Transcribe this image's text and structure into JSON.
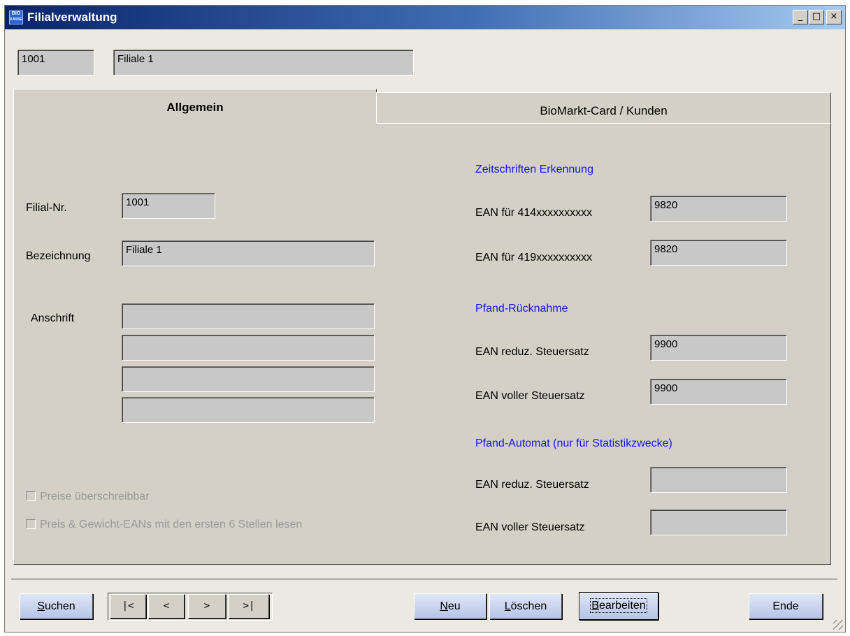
{
  "window": {
    "title": "Filialverwaltung",
    "logo_line1": "BIO",
    "logo_line2": "KASSE",
    "minimize": "_",
    "maximize": "□",
    "close": "×"
  },
  "header": {
    "number": "1001",
    "name": "Filiale 1"
  },
  "tabs": [
    {
      "label": "Allgemein",
      "active": true
    },
    {
      "label": "BioMarkt-Card / Kunden",
      "active": false
    }
  ],
  "general": {
    "filial_nr_label": "Filial-Nr.",
    "filial_nr_value": "1001",
    "bezeichnung_label": "Bezeichnung",
    "bezeichnung_value": "Filiale 1",
    "anschrift_label": "Anschrift",
    "anschrift_lines": [
      "",
      "",
      "",
      ""
    ],
    "checkbox_preise": "Preise überschreibbar",
    "checkbox_ean": "Preis & Gewicht-EANs mit den ersten 6 Stellen lesen"
  },
  "zeitschriften": {
    "heading": "Zeitschriften Erkennung",
    "ean414_label": "EAN für 414xxxxxxxxxx",
    "ean414_value": "9820",
    "ean419_label": "EAN für 419xxxxxxxxxx",
    "ean419_value": "9820"
  },
  "pfand_ruecknahme": {
    "heading": "Pfand-Rücknahme",
    "reduz_label": "EAN reduz. Steuersatz",
    "reduz_value": "9900",
    "voll_label": "EAN voller Steuersatz",
    "voll_value": "9900"
  },
  "pfand_automat": {
    "heading": "Pfand-Automat (nur für Statistikzwecke)",
    "reduz_label": "EAN reduz. Steuersatz",
    "reduz_value": "",
    "voll_label": "EAN voller Steuersatz",
    "voll_value": ""
  },
  "buttons": {
    "suchen_u": "S",
    "suchen_rest": "uchen",
    "nav_first": "|<",
    "nav_prev": "<",
    "nav_next": ">",
    "nav_last": ">|",
    "neu_u": "N",
    "neu_rest": "eu",
    "loeschen_u": "L",
    "loeschen_rest": "öschen",
    "bearbeiten_u": "B",
    "bearbeiten_rest": "earbeiten",
    "ende": "Ende"
  }
}
